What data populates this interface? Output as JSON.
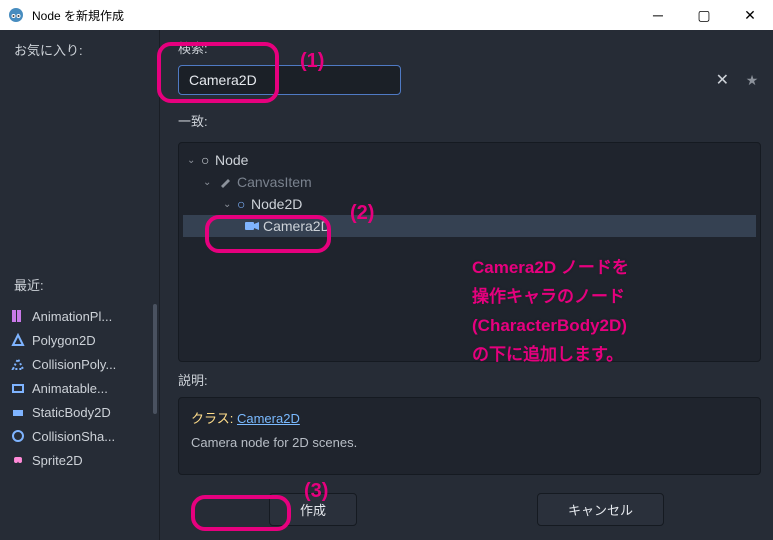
{
  "titlebar": {
    "title": "Node を新規作成"
  },
  "sidebar": {
    "favorites_label": "お気に入り:",
    "recent_label": "最近:",
    "recent_items": [
      {
        "label": "AnimationPl...",
        "color": "#c979e8"
      },
      {
        "label": "Polygon2D",
        "color": "#7fb4ff"
      },
      {
        "label": "CollisionPoly...",
        "color": "#7fb4ff"
      },
      {
        "label": "Animatable...",
        "color": "#7fb4ff"
      },
      {
        "label": "StaticBody2D",
        "color": "#7fb4ff"
      },
      {
        "label": "CollisionSha...",
        "color": "#7fb4ff"
      },
      {
        "label": "Sprite2D",
        "color": "#7fb4ff"
      }
    ]
  },
  "search": {
    "label": "検索:",
    "value": "Camera2D"
  },
  "match_label": "一致:",
  "tree": {
    "root": "Node",
    "l1": "CanvasItem",
    "l2": "Node2D",
    "l3": "Camera2D"
  },
  "description": {
    "label": "説明:",
    "class_prefix": "クラス:",
    "class_name": "Camera2D",
    "text": "Camera node for 2D scenes."
  },
  "buttons": {
    "create": "作成",
    "cancel": "キャンセル"
  },
  "annotations": {
    "n1": "(1)",
    "n2": "(2)",
    "n3": "(3)",
    "text": "Camera2D ノードを\n操作キャラのノード\n(CharacterBody2D)\nの下に追加します。"
  }
}
